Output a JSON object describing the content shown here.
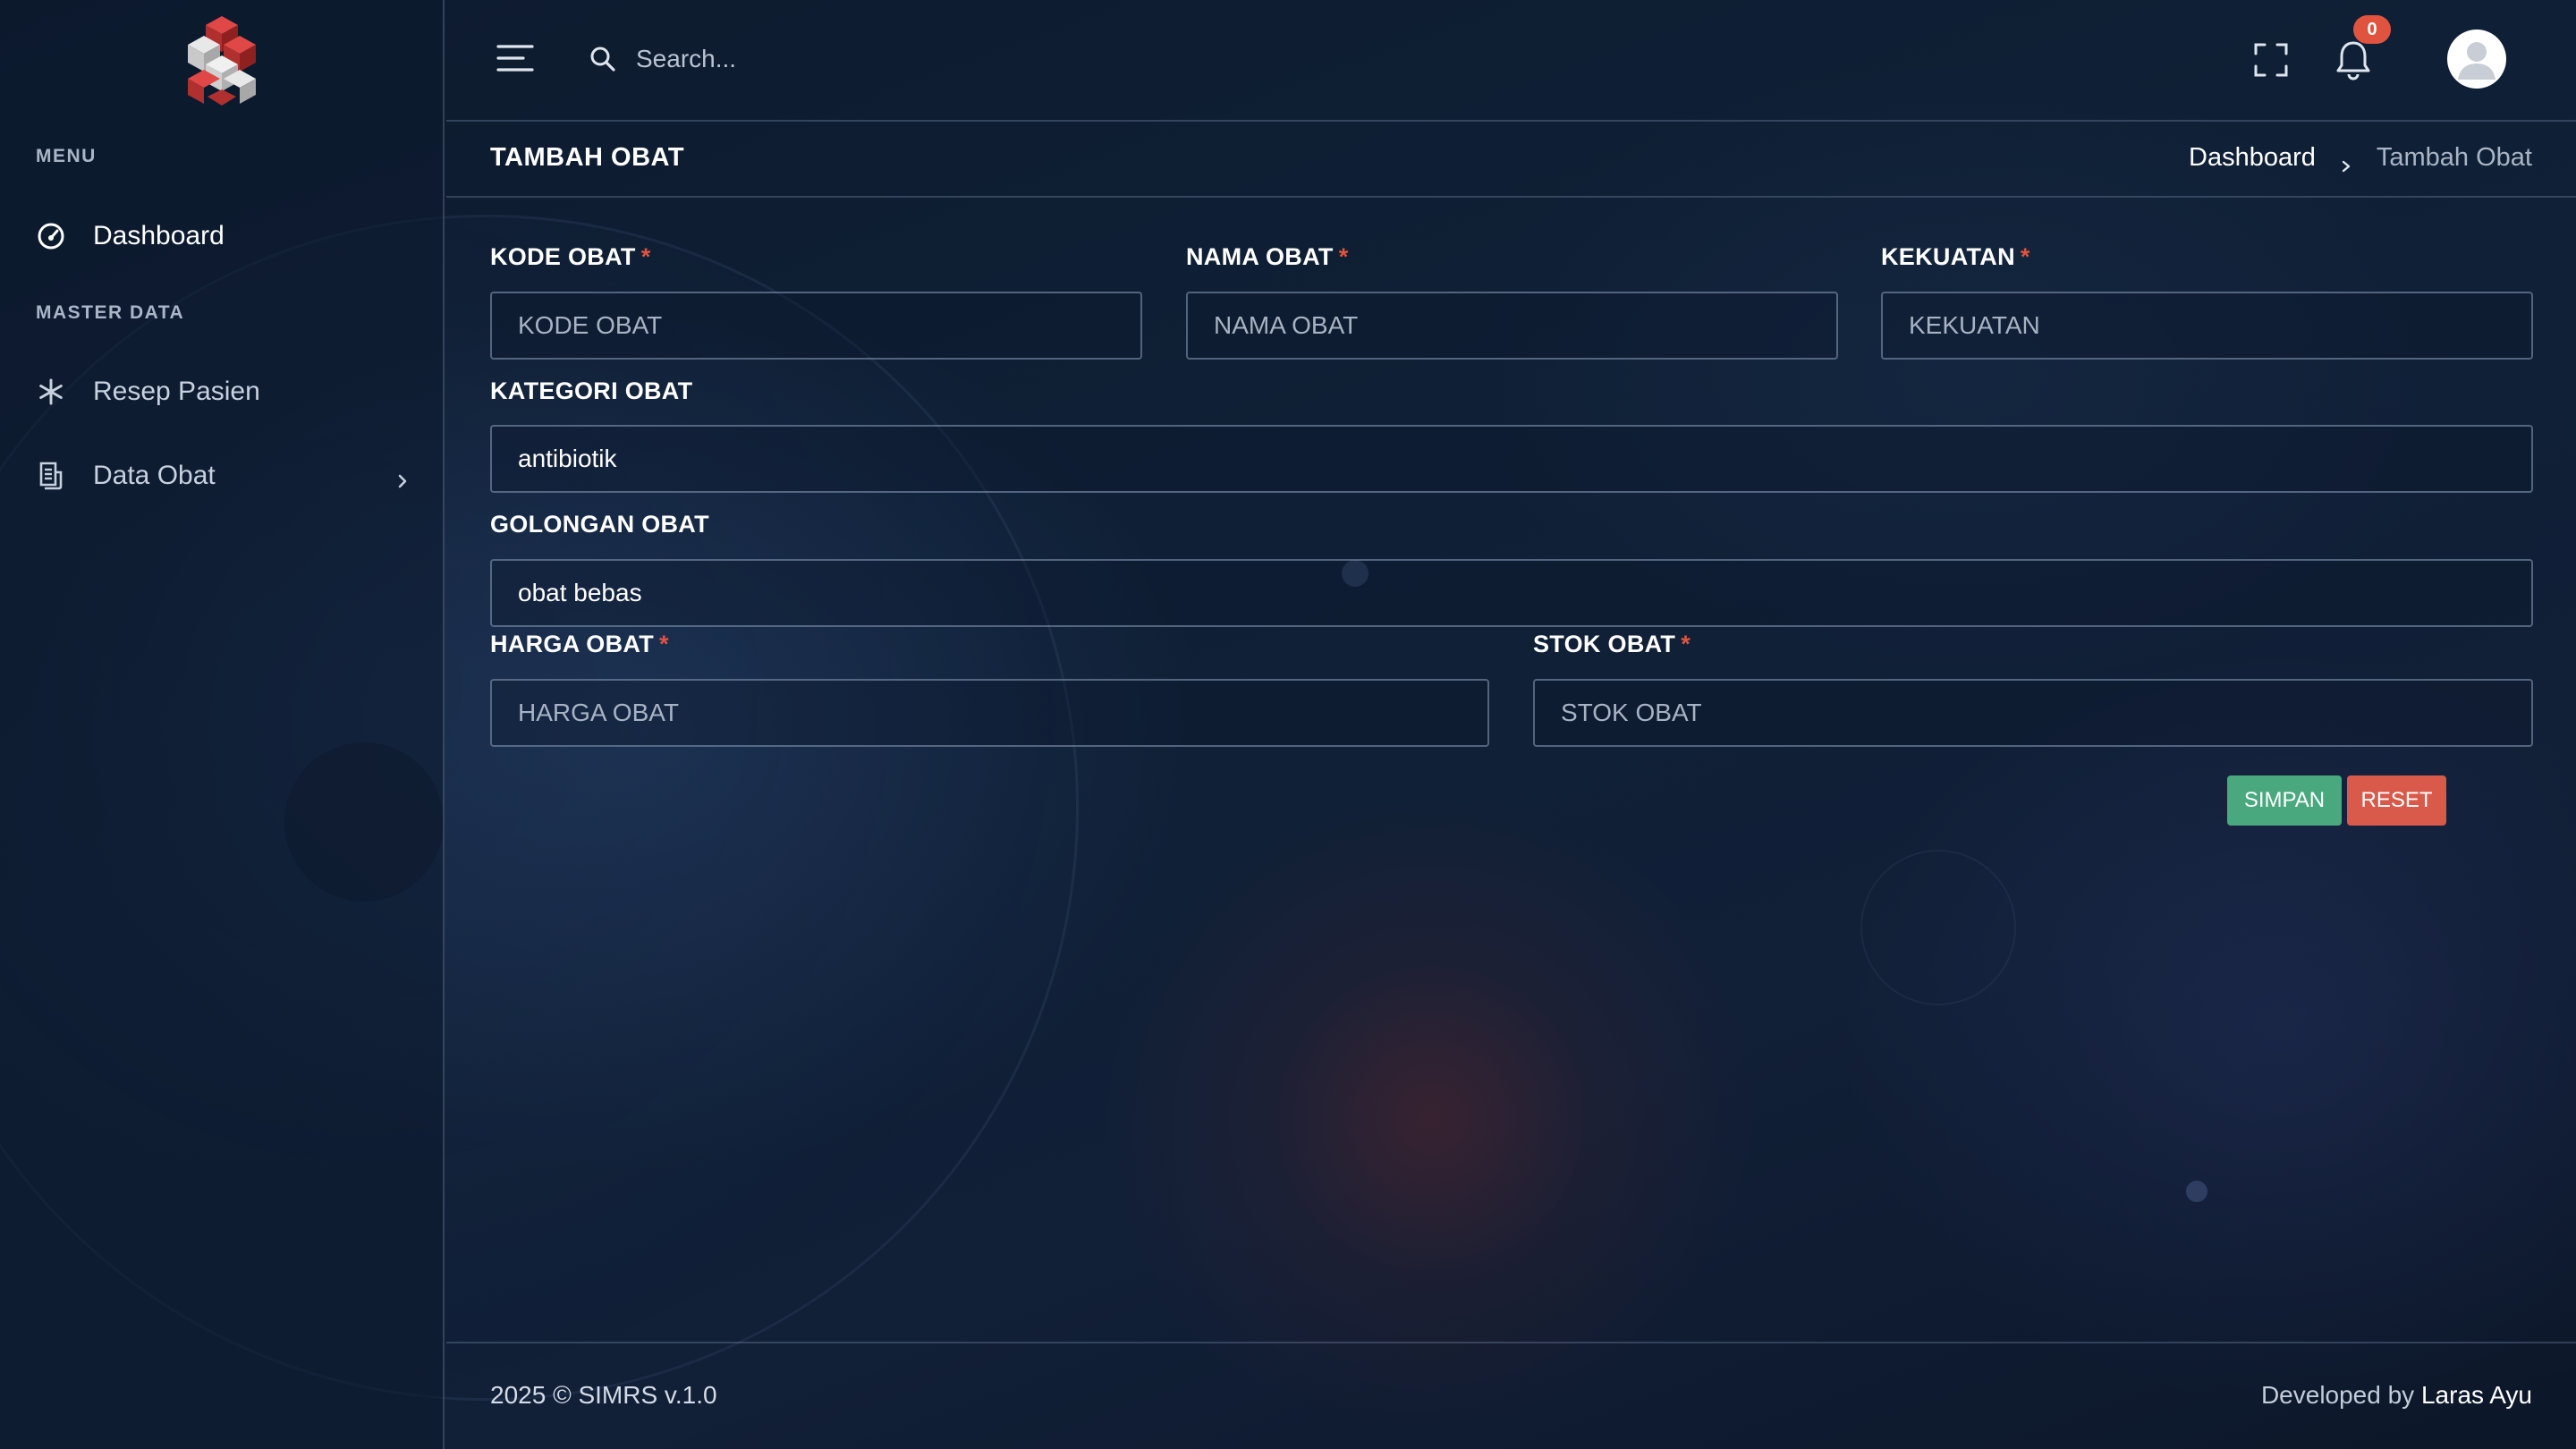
{
  "sidebar": {
    "logo": "cube-logo",
    "sections": [
      {
        "label": "MENU"
      },
      {
        "label": "MASTER DATA"
      }
    ],
    "items": [
      {
        "label": "Dashboard",
        "icon": "dashboard-gauge-icon",
        "active": true
      },
      {
        "label": "Resep Pasien",
        "icon": "asterisk-icon"
      },
      {
        "label": "Data Obat",
        "icon": "document-list-icon",
        "has_submenu": true
      }
    ]
  },
  "header": {
    "menu_icon": "hamburger-icon",
    "search": {
      "placeholder": "Search...",
      "value": "",
      "icon": "search-icon"
    },
    "fullscreen_icon": "fullscreen-icon",
    "notifications": {
      "icon": "bell-icon",
      "count": "0"
    },
    "avatar_icon": "user-avatar-icon"
  },
  "page": {
    "title": "TAMBAH OBAT",
    "breadcrumb": {
      "parent": "Dashboard",
      "current": "Tambah Obat"
    }
  },
  "form": {
    "kode_obat": {
      "label": "KODE OBAT",
      "required_mark": "*",
      "placeholder": "KODE OBAT",
      "value": ""
    },
    "nama_obat": {
      "label": "NAMA OBAT",
      "required_mark": "*",
      "placeholder": "NAMA OBAT",
      "value": ""
    },
    "kekuatan": {
      "label": "KEKUATAN",
      "required_mark": "*",
      "placeholder": "KEKUATAN",
      "value": ""
    },
    "kategori_obat": {
      "label": "KATEGORI OBAT",
      "value": "antibiotik"
    },
    "golongan_obat": {
      "label": "GOLONGAN OBAT",
      "value": "obat bebas"
    },
    "harga_obat": {
      "label": "HARGA OBAT",
      "required_mark": "*",
      "placeholder": "HARGA OBAT",
      "value": ""
    },
    "stok_obat": {
      "label": "STOK OBAT",
      "required_mark": "*",
      "placeholder": "STOK OBAT",
      "value": ""
    },
    "save_label": "SIMPAN",
    "reset_label": "RESET"
  },
  "footer": {
    "copyright": "2025 © SIMRS v.1.0",
    "developed_by": "Developed by",
    "author": "Laras Ayu"
  },
  "colors": {
    "background": "#0f1f36",
    "save_button": "#4aa87f",
    "reset_button": "#d9594a",
    "required_star": "#e0533f",
    "badge": "#e0533f"
  }
}
